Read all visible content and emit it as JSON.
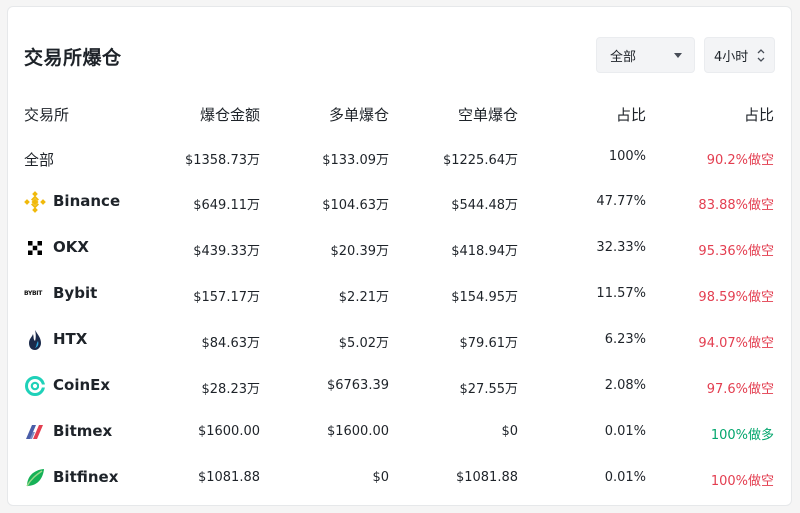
{
  "header": {
    "title": "交易所爆仓"
  },
  "filters": {
    "exchange_selected": "全部",
    "time_selected": "4小时"
  },
  "table": {
    "columns": [
      "交易所",
      "爆仓金额",
      "多单爆仓",
      "空单爆仓",
      "占比",
      "占比"
    ],
    "rows": [
      {
        "exchange": "全部",
        "total": "$1358.73万",
        "long": "$133.09万",
        "short": "$1225.64万",
        "share": "100%",
        "ratio": "90.2%做空",
        "ratio_type": "short",
        "logo": ""
      },
      {
        "exchange": "Binance",
        "total": "$649.11万",
        "long": "$104.63万",
        "short": "$544.48万",
        "share": "47.77%",
        "ratio": "83.88%做空",
        "ratio_type": "short",
        "logo": "binance-logo"
      },
      {
        "exchange": "OKX",
        "total": "$439.33万",
        "long": "$20.39万",
        "short": "$418.94万",
        "share": "32.33%",
        "ratio": "95.36%做空",
        "ratio_type": "short",
        "logo": "okx-logo"
      },
      {
        "exchange": "Bybit",
        "total": "$157.17万",
        "long": "$2.21万",
        "short": "$154.95万",
        "share": "11.57%",
        "ratio": "98.59%做空",
        "ratio_type": "short",
        "logo": "bybit-logo",
        "logo_text": "BYBIT"
      },
      {
        "exchange": "HTX",
        "total": "$84.63万",
        "long": "$5.02万",
        "short": "$79.61万",
        "share": "6.23%",
        "ratio": "94.07%做空",
        "ratio_type": "short",
        "logo": "htx-logo"
      },
      {
        "exchange": "CoinEx",
        "total": "$28.23万",
        "long": "$6763.39",
        "short": "$27.55万",
        "share": "2.08%",
        "ratio": "97.6%做空",
        "ratio_type": "short",
        "logo": "coinex-logo"
      },
      {
        "exchange": "Bitmex",
        "total": "$1600.00",
        "long": "$1600.00",
        "short": "$0",
        "share": "0.01%",
        "ratio": "100%做多",
        "ratio_type": "long",
        "logo": "bitmex-logo"
      },
      {
        "exchange": "Bitfinex",
        "total": "$1081.88",
        "long": "$0",
        "short": "$1081.88",
        "share": "0.01%",
        "ratio": "100%做空",
        "ratio_type": "short",
        "logo": "bitfinex-logo"
      }
    ]
  },
  "colors": {
    "short": "#e33e50",
    "long": "#03a66d",
    "binance": "#f0b90b",
    "coinex": "#1fd1b9",
    "bitmex": "#4a5ea8",
    "bitfinex": "#16b157"
  }
}
